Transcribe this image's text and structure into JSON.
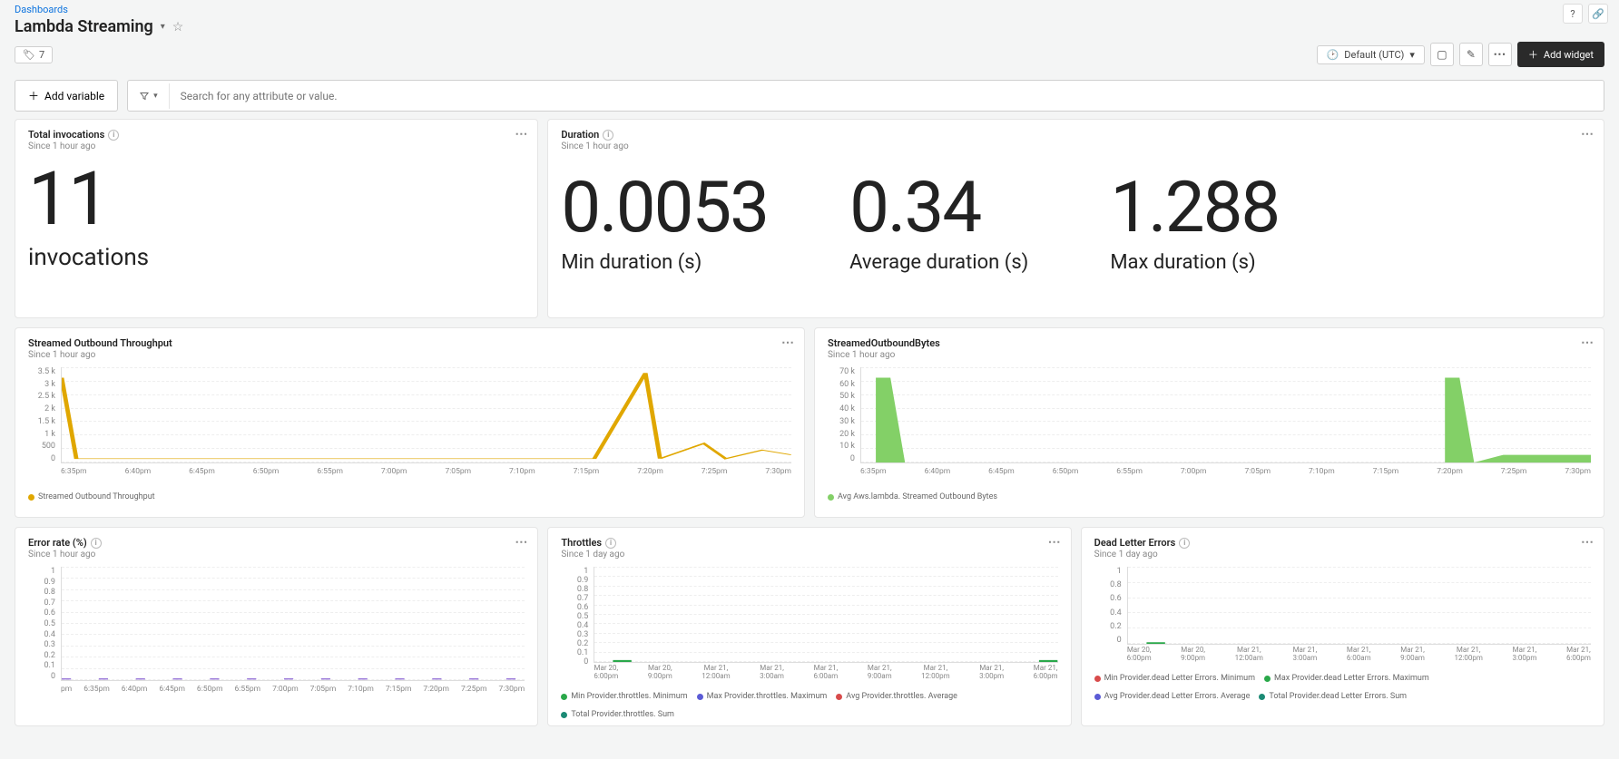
{
  "breadcrumb": "Dashboards",
  "title": "Lambda Streaming",
  "tag_count": "7",
  "time_picker": "Default (UTC)",
  "add_widget": "Add widget",
  "add_variable": "Add variable",
  "search_placeholder": "Search for any attribute or value.",
  "cards": {
    "invocations": {
      "title": "Total invocations",
      "sub": "Since 1 hour ago",
      "value": "11",
      "label": "invocations"
    },
    "duration": {
      "title": "Duration",
      "sub": "Since 1 hour ago",
      "min_v": "0.0053",
      "min_l": "Min duration (s)",
      "avg_v": "0.34",
      "avg_l": "Average duration (s)",
      "max_v": "1.288",
      "max_l": "Max duration (s)"
    },
    "throughput": {
      "title": "Streamed Outbound Throughput",
      "sub": "Since 1 hour ago",
      "legend": "Streamed Outbound Throughput"
    },
    "bytes": {
      "title": "StreamedOutboundBytes",
      "sub": "Since 1 hour ago",
      "legend": "Avg Aws.lambda. Streamed Outbound Bytes"
    },
    "error": {
      "title": "Error rate (%)",
      "sub": "Since 1 hour ago"
    },
    "throttles": {
      "title": "Throttles",
      "sub": "Since 1 day ago",
      "leg1": "Min Provider.throttles. Minimum",
      "leg2": "Max Provider.throttles. Maximum",
      "leg3": "Avg Provider.throttles. Average",
      "leg4": "Total Provider.throttles. Sum"
    },
    "dle": {
      "title": "Dead Letter Errors",
      "sub": "Since 1 day ago",
      "leg1": "Min Provider.dead Letter Errors. Minimum",
      "leg2": "Max Provider.dead Letter Errors. Maximum",
      "leg3": "Avg Provider.dead Letter Errors. Average",
      "leg4": "Total Provider.dead Letter Errors. Sum"
    }
  },
  "axes": {
    "throughput_y": [
      "3.5 k",
      "3 k",
      "2.5 k",
      "2 k",
      "1.5 k",
      "1 k",
      "500",
      "0"
    ],
    "throughput_x": [
      "6:35pm",
      "6:40pm",
      "6:45pm",
      "6:50pm",
      "6:55pm",
      "7:00pm",
      "7:05pm",
      "7:10pm",
      "7:15pm",
      "7:20pm",
      "7:25pm",
      "7:30pm"
    ],
    "bytes_y": [
      "70 k",
      "60 k",
      "50 k",
      "40 k",
      "30 k",
      "20 k",
      "10 k",
      "0"
    ],
    "bytes_x": [
      "6:35pm",
      "6:40pm",
      "6:45pm",
      "6:50pm",
      "6:55pm",
      "7:00pm",
      "7:05pm",
      "7:10pm",
      "7:15pm",
      "7:20pm",
      "7:25pm",
      "7:30pm"
    ],
    "error_y": [
      "1",
      "0.9",
      "0.8",
      "0.7",
      "0.6",
      "0.5",
      "0.4",
      "0.3",
      "0.2",
      "0.1",
      "0"
    ],
    "error_x": [
      "pm",
      "6:35pm",
      "6:40pm",
      "6:45pm",
      "6:50pm",
      "6:55pm",
      "7:00pm",
      "7:05pm",
      "7:10pm",
      "7:15pm",
      "7:20pm",
      "7:25pm",
      "7:30pm"
    ],
    "throttle_y": [
      "1",
      "0.9",
      "0.8",
      "0.7",
      "0.6",
      "0.5",
      "0.4",
      "0.3",
      "0.2",
      "0.1",
      "0"
    ],
    "day_x": [
      {
        "a": "Mar 20,",
        "b": "6:00pm"
      },
      {
        "a": "Mar 20,",
        "b": "9:00pm"
      },
      {
        "a": "Mar 21,",
        "b": "12:00am"
      },
      {
        "a": "Mar 21,",
        "b": "3:00am"
      },
      {
        "a": "Mar 21,",
        "b": "6:00am"
      },
      {
        "a": "Mar 21,",
        "b": "9:00am"
      },
      {
        "a": "Mar 21,",
        "b": "12:00pm"
      },
      {
        "a": "Mar 21,",
        "b": "3:00pm"
      },
      {
        "a": "Mar 21,",
        "b": "6:00pm"
      }
    ],
    "dle_y": [
      "1",
      "0.8",
      "0.6",
      "0.4",
      "0.2",
      "0"
    ]
  },
  "chart_data": [
    {
      "id": "throughput",
      "type": "line",
      "title": "Streamed Outbound Throughput",
      "xlabel": "",
      "ylabel": "",
      "ylim": [
        0,
        3500
      ],
      "categories": [
        "6:35pm",
        "6:40pm",
        "6:45pm",
        "6:50pm",
        "6:55pm",
        "7:00pm",
        "7:05pm",
        "7:10pm",
        "7:15pm",
        "7:20pm",
        "7:25pm",
        "7:30pm"
      ],
      "series": [
        {
          "name": "Streamed Outbound Throughput",
          "color": "#e0a700",
          "values": [
            3100,
            150,
            150,
            150,
            150,
            150,
            150,
            150,
            150,
            3300,
            700,
            450
          ]
        }
      ]
    },
    {
      "id": "bytes",
      "type": "area",
      "title": "StreamedOutboundBytes",
      "xlabel": "",
      "ylabel": "",
      "ylim": [
        0,
        70000
      ],
      "categories": [
        "6:35pm",
        "6:40pm",
        "6:45pm",
        "6:50pm",
        "6:55pm",
        "7:00pm",
        "7:05pm",
        "7:10pm",
        "7:15pm",
        "7:20pm",
        "7:25pm",
        "7:30pm"
      ],
      "series": [
        {
          "name": "Avg Aws.lambda. Streamed Outbound Bytes",
          "color": "#83d067",
          "values": [
            62000,
            0,
            0,
            0,
            0,
            0,
            0,
            0,
            0,
            62000,
            6000,
            6000
          ]
        }
      ]
    },
    {
      "id": "error",
      "type": "line",
      "title": "Error rate (%)",
      "xlabel": "",
      "ylabel": "",
      "ylim": [
        0,
        1
      ],
      "categories": [
        "6:35pm",
        "6:40pm",
        "6:45pm",
        "6:50pm",
        "6:55pm",
        "7:00pm",
        "7:05pm",
        "7:10pm",
        "7:15pm",
        "7:20pm",
        "7:25pm",
        "7:30pm"
      ],
      "series": [
        {
          "name": "Error rate",
          "color": "#8a63d2",
          "values": [
            0,
            0,
            0,
            0,
            0,
            0,
            0,
            0,
            0,
            0,
            0,
            0
          ]
        }
      ]
    },
    {
      "id": "throttles",
      "type": "line",
      "title": "Throttles",
      "xlabel": "",
      "ylabel": "",
      "ylim": [
        0,
        1
      ],
      "categories": [
        "Mar 20 6:00pm",
        "Mar 20 9:00pm",
        "Mar 21 12:00am",
        "Mar 21 3:00am",
        "Mar 21 6:00am",
        "Mar 21 9:00am",
        "Mar 21 12:00pm",
        "Mar 21 3:00pm",
        "Mar 21 6:00pm"
      ],
      "series": [
        {
          "name": "Min Provider.throttles. Minimum",
          "color": "#2aa84a",
          "values": [
            0,
            0,
            0,
            0,
            0,
            0,
            0,
            0,
            0
          ]
        },
        {
          "name": "Max Provider.throttles. Maximum",
          "color": "#5b5bd6",
          "values": [
            0,
            0,
            0,
            0,
            0,
            0,
            0,
            0,
            0
          ]
        },
        {
          "name": "Avg Provider.throttles. Average",
          "color": "#d84b4b",
          "values": [
            0,
            0,
            0,
            0,
            0,
            0,
            0,
            0,
            0
          ]
        },
        {
          "name": "Total Provider.throttles. Sum",
          "color": "#1b8a74",
          "values": [
            0,
            0,
            0,
            0,
            0,
            0,
            0,
            0,
            0
          ]
        }
      ]
    },
    {
      "id": "dle",
      "type": "line",
      "title": "Dead Letter Errors",
      "xlabel": "",
      "ylabel": "",
      "ylim": [
        0,
        1
      ],
      "categories": [
        "Mar 20 6:00pm",
        "Mar 20 9:00pm",
        "Mar 21 12:00am",
        "Mar 21 3:00am",
        "Mar 21 6:00am",
        "Mar 21 9:00am",
        "Mar 21 12:00pm",
        "Mar 21 3:00pm",
        "Mar 21 6:00pm"
      ],
      "series": [
        {
          "name": "Min Provider.dead Letter Errors. Minimum",
          "color": "#d84b4b",
          "values": [
            0,
            0,
            0,
            0,
            0,
            0,
            0,
            0,
            0
          ]
        },
        {
          "name": "Max Provider.dead Letter Errors. Maximum",
          "color": "#2aa84a",
          "values": [
            0,
            0,
            0,
            0,
            0,
            0,
            0,
            0,
            0
          ]
        },
        {
          "name": "Avg Provider.dead Letter Errors. Average",
          "color": "#5b5bd6",
          "values": [
            0,
            0,
            0,
            0,
            0,
            0,
            0,
            0,
            0
          ]
        },
        {
          "name": "Total Provider.dead Letter Errors. Sum",
          "color": "#1b8a74",
          "values": [
            0,
            0,
            0,
            0,
            0,
            0,
            0,
            0,
            0
          ]
        }
      ]
    }
  ]
}
